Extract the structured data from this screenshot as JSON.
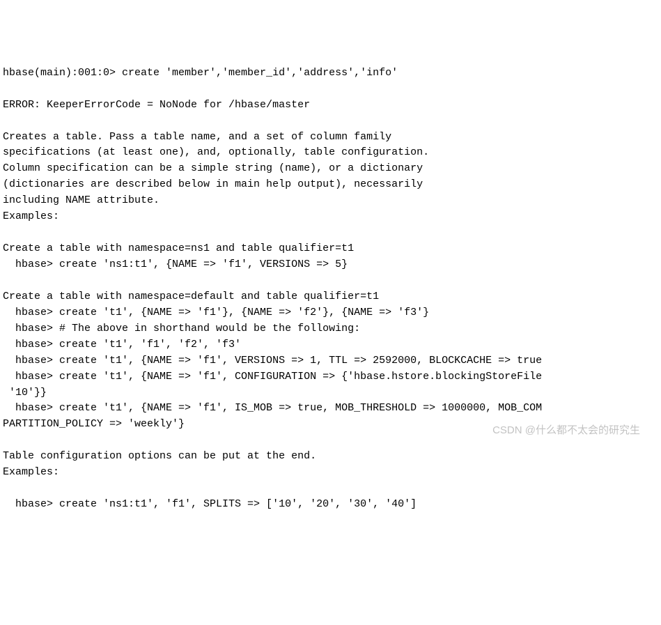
{
  "terminal": {
    "line01": "hbase(main):001:0> create 'member','member_id','address','info'",
    "line02": "",
    "line03": "ERROR: KeeperErrorCode = NoNode for /hbase/master",
    "line04": "",
    "line05": "Creates a table. Pass a table name, and a set of column family",
    "line06": "specifications (at least one), and, optionally, table configuration.",
    "line07": "Column specification can be a simple string (name), or a dictionary",
    "line08": "(dictionaries are described below in main help output), necessarily",
    "line09": "including NAME attribute.",
    "line10": "Examples:",
    "line11": "",
    "line12": "Create a table with namespace=ns1 and table qualifier=t1",
    "line13": "  hbase> create 'ns1:t1', {NAME => 'f1', VERSIONS => 5}",
    "line14": "",
    "line15": "Create a table with namespace=default and table qualifier=t1",
    "line16": "  hbase> create 't1', {NAME => 'f1'}, {NAME => 'f2'}, {NAME => 'f3'}",
    "line17": "  hbase> # The above in shorthand would be the following:",
    "line18": "  hbase> create 't1', 'f1', 'f2', 'f3'",
    "line19": "  hbase> create 't1', {NAME => 'f1', VERSIONS => 1, TTL => 2592000, BLOCKCACHE => true",
    "line20": "  hbase> create 't1', {NAME => 'f1', CONFIGURATION => {'hbase.hstore.blockingStoreFile",
    "line21": " '10'}}",
    "line22": "  hbase> create 't1', {NAME => 'f1', IS_MOB => true, MOB_THRESHOLD => 1000000, MOB_COM",
    "line23": "PARTITION_POLICY => 'weekly'}",
    "line24": "",
    "line25": "Table configuration options can be put at the end.",
    "line26": "Examples:",
    "line27": "",
    "line28": "  hbase> create 'ns1:t1', 'f1', SPLITS => ['10', '20', '30', '40']"
  },
  "watermark": "CSDN @什么都不太会的研究生"
}
